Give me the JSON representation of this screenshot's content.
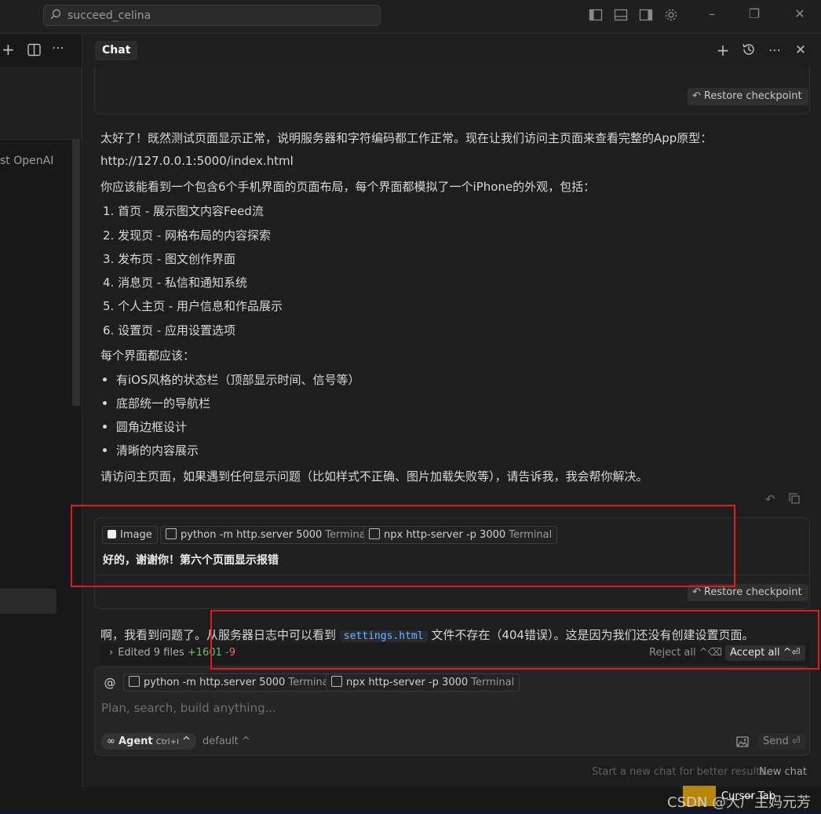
{
  "titlebar": {
    "search_text": "succeed_celina"
  },
  "left_panel": {
    "truncated_text": "st OpenAI"
  },
  "chat_header": {
    "tab_label": "Chat"
  },
  "restore_label": "Restore checkpoint",
  "assistant_message": {
    "intro": "太好了！既然测试页面显示正常，说明服务器和字符编码都工作正常。现在让我们访问主页面来查看完整的App原型：",
    "url": "http://127.0.0.1:5000/index.html",
    "lead": "你应该能看到一个包含6个手机界面的页面布局，每个界面都模拟了一个iPhone的外观，包括：",
    "numbered": [
      "1. 首页 - 展示图文内容Feed流",
      "2. 发现页 - 网格布局的内容探索",
      "3. 发布页 - 图文创作界面",
      "4. 消息页 - 私信和通知系统",
      "5. 个人主页 - 用户信息和作品展示",
      "6. 设置页 - 应用设置选项"
    ],
    "requirements_title": "每个界面都应该：",
    "bullets": [
      "有iOS风格的状态栏（顶部显示时间、信号等）",
      "底部统一的导航栏",
      "圆角边框设计",
      "清晰的内容展示"
    ],
    "closing": "请访问主页面，如果遇到任何显示问题（比如样式不正确、图片加载失败等），请告诉我，我会帮你解决。"
  },
  "user_message": {
    "chips": [
      {
        "label": "Image",
        "sub": ""
      },
      {
        "label": "python -m http.server 5000",
        "sub": "Terminal"
      },
      {
        "label": "npx http-server -p 3000",
        "sub": "Terminal"
      }
    ],
    "text": "好的，谢谢你！第六个页面显示报错"
  },
  "assistant_reply": {
    "before": "啊，我看到问题了。从服务器日志中可以看到",
    "code": "settings.html",
    "after": "文件不存在（404错误）。这是因为我们还没有创建设置页面。"
  },
  "edit_bar": {
    "label": "Edited 9 files",
    "added": "+1601",
    "removed": "-9",
    "reject": "Reject all ^⌫",
    "accept": "Accept all ^⏎"
  },
  "composer": {
    "at": "@",
    "chips": [
      {
        "label": "python -m http.server 5000",
        "sub": "Terminal"
      },
      {
        "label": "npx http-server -p 3000",
        "sub": "Terminal"
      }
    ],
    "placeholder": "Plan, search, build anything...",
    "agent_label": "Agent",
    "agent_shortcut": "Ctrl+I",
    "model": "default ^",
    "send": "Send ⏎"
  },
  "footer": {
    "hint": "Start a new chat for better results.",
    "new_chat": "New chat"
  },
  "statusbar": {
    "cursor_tab": "Cursor Tab",
    "watermark": "CSDN @大厂主妈元芳"
  }
}
